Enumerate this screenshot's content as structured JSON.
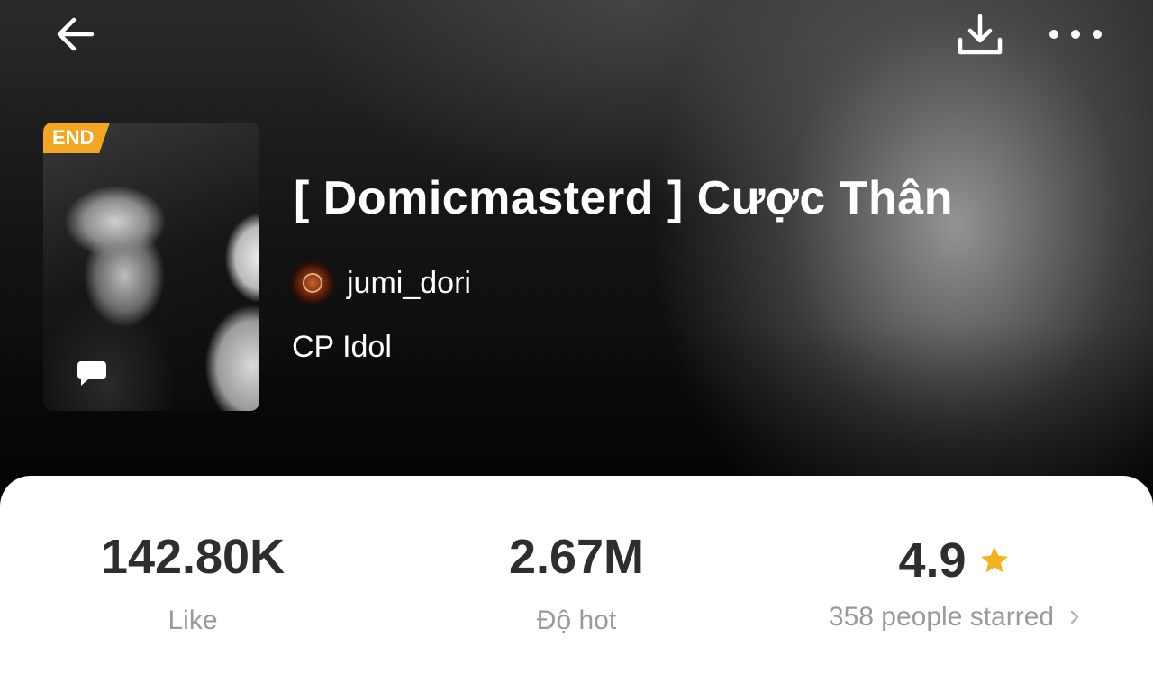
{
  "header": {
    "back_icon": "arrow-left-icon",
    "download_icon": "download-icon",
    "more_icon": "more-horizontal-icon"
  },
  "book": {
    "badge": "END",
    "title": "[ Domicmasterd ] Cược Thân",
    "author": "jumi_dori",
    "category": "CP Idol",
    "cover_icon": "chat-bubble-icon"
  },
  "stats": {
    "likes_value": "142.80K",
    "likes_label": "Like",
    "hot_value": "2.67M",
    "hot_label": "Độ hot",
    "rating_value": "4.9",
    "rating_label": "358 people starred"
  },
  "colors": {
    "badge": "#f2a622",
    "star": "#f5b21b",
    "stat_text": "#2e2e2e",
    "label_text": "#9a9a9a"
  }
}
